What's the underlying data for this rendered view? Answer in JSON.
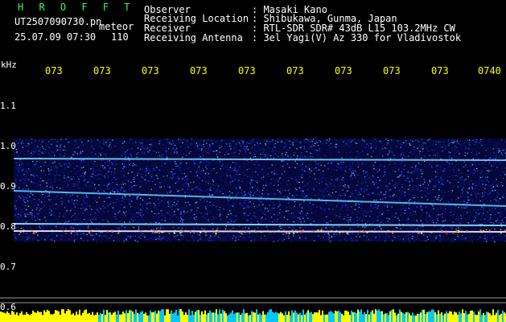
{
  "header": {
    "title_logo": "H R O F F T",
    "filename": "UT2507090730.pn",
    "mode": "meteor",
    "datetime": "25.07.09 07:30",
    "count": "110",
    "fields": [
      {
        "label": "Observer",
        "value": ": Masaki Kano"
      },
      {
        "label": "Receiving Location",
        "value": ": Shibukawa, Gunma, Japan"
      },
      {
        "label": "Receiver",
        "value": ": RTL-SDR SDR# 43dB L15 103.2MHz CW"
      },
      {
        "label": "Receiving Antenna",
        "value": ": 3el Yagi(V) Az 330 for Vladivostok"
      }
    ]
  },
  "axis": {
    "unit": "kHz",
    "y_labels": [
      "1.1",
      "1.0",
      "0.9",
      "0.8",
      "0.7",
      "0.6"
    ],
    "time_labels": [
      "073",
      "073",
      "073",
      "073",
      "073",
      "073",
      "073",
      "073",
      "073",
      "0740"
    ]
  },
  "colors": {
    "background": "#000000",
    "header_text": "#ffffff",
    "logo": "#3cff3c",
    "time_labels": "#ffff00",
    "bottom_bar_base": "#00c8ff",
    "bottom_bar_peaks": "#ffff00"
  }
}
